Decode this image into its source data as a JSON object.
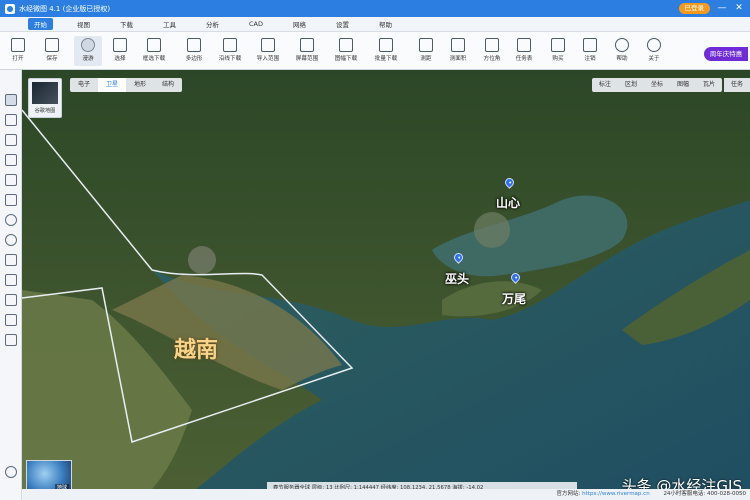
{
  "window": {
    "title": "水经微图 4.1 (企业版已授权)",
    "login_label": "已登录",
    "minimize": "—",
    "close": "✕"
  },
  "menu": {
    "items": [
      "开始",
      "视图",
      "下载",
      "工具",
      "分析",
      "CAD",
      "网络",
      "设置",
      "帮助"
    ]
  },
  "toolbar": {
    "tools": [
      {
        "label": "打开",
        "icon": "folder-icon"
      },
      {
        "label": "保存",
        "icon": "save-icon"
      },
      {
        "label": "漫游",
        "icon": "hand-icon"
      },
      {
        "label": "选择",
        "icon": "pointer-icon"
      },
      {
        "label": "框选下载",
        "icon": "rect-select-icon"
      },
      {
        "label": "多边形",
        "icon": "polygon-icon"
      },
      {
        "label": "沿线下载",
        "icon": "line-download-icon"
      },
      {
        "label": "导入范围",
        "icon": "import-range-icon"
      },
      {
        "label": "屏幕范围",
        "icon": "screen-range-icon"
      },
      {
        "label": "图幅下载",
        "icon": "sheet-download-icon"
      },
      {
        "label": "批量下载",
        "icon": "batch-download-icon"
      },
      {
        "label": "测距",
        "icon": "ruler-icon"
      },
      {
        "label": "测面积",
        "icon": "area-icon"
      },
      {
        "label": "方位角",
        "icon": "azimuth-icon"
      },
      {
        "label": "任务表",
        "icon": "task-icon"
      },
      {
        "label": "购买",
        "icon": "cart-icon"
      },
      {
        "label": "注销",
        "icon": "lock-icon"
      },
      {
        "label": "帮助",
        "icon": "help-icon"
      },
      {
        "label": "关于",
        "icon": "info-icon"
      }
    ],
    "promo": "周年庆特惠"
  },
  "map": {
    "layer_tabs": [
      "电子",
      "卫星",
      "地形",
      "结构"
    ],
    "active_layer": "卫星",
    "thumbnail_label": "谷歌地图",
    "right_tools": [
      "标注",
      "区划",
      "坐标",
      "图幅",
      "瓦片"
    ],
    "task_list_label": "任务",
    "places": [
      {
        "name": "山心"
      },
      {
        "name": "巫头"
      },
      {
        "name": "万尾"
      }
    ],
    "region_label": "越南",
    "globe_label": "地球",
    "status": "春节服务器全球   层级: 13   比例尺: 1:144447   经纬度: 108.1234, 21.5678   海拔: -14.02",
    "watermark": "头条 @水经注GIS"
  },
  "footer": {
    "website_label": "官方网站:",
    "website": "https://www.rivermap.cn",
    "hotline": "24小时客服电话: 400-028-0050"
  }
}
